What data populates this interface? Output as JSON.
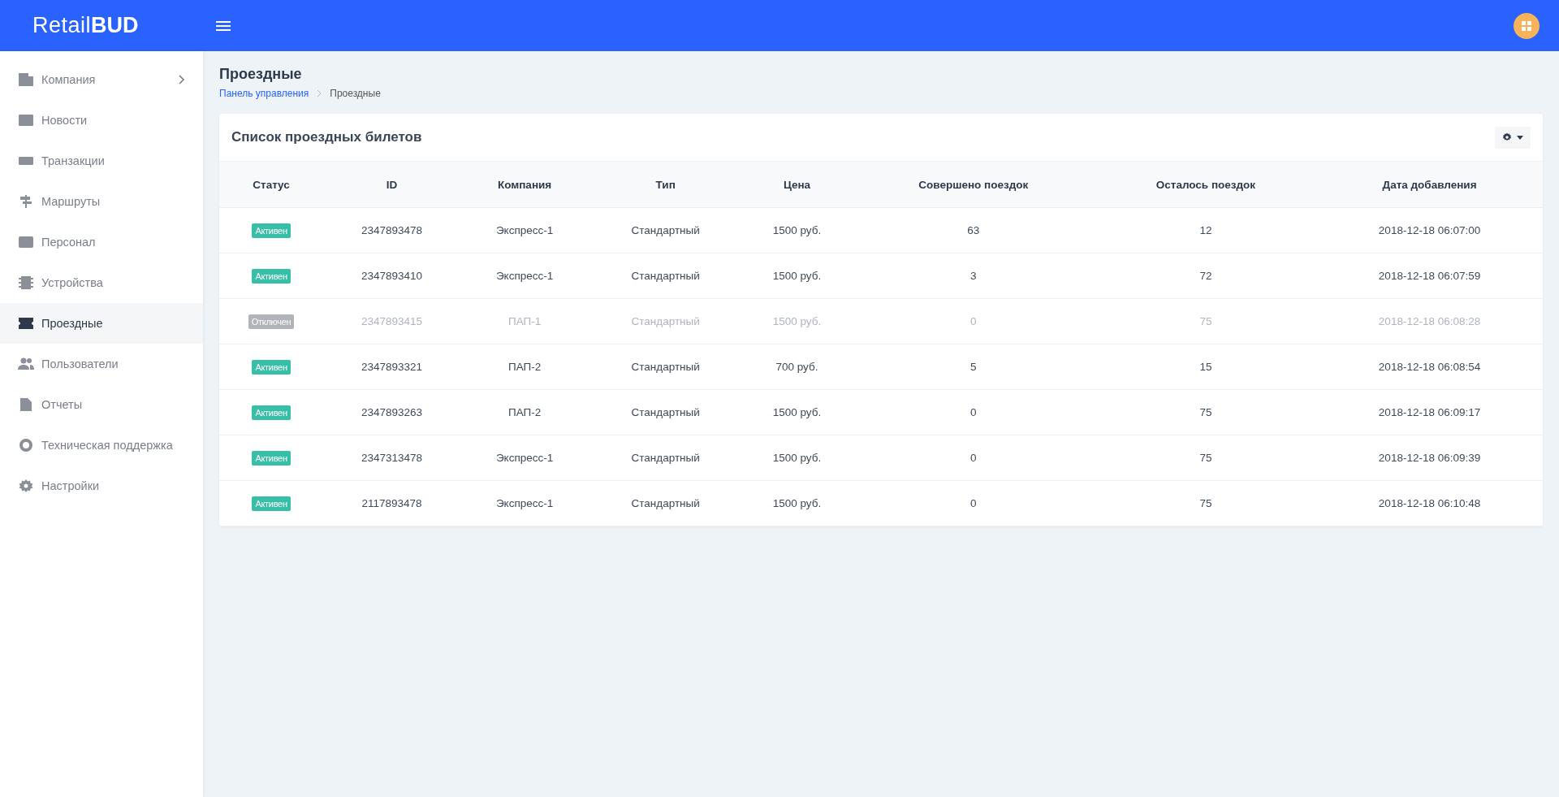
{
  "header": {
    "logo_light": "Retail",
    "logo_bold": "BUD"
  },
  "sidebar": {
    "items": [
      {
        "label": "Компания",
        "selected": false,
        "expandable": true
      },
      {
        "label": "Новости",
        "selected": false,
        "expandable": false
      },
      {
        "label": "Транзакции",
        "selected": false,
        "expandable": false
      },
      {
        "label": "Маршруты",
        "selected": false,
        "expandable": false
      },
      {
        "label": "Персонал",
        "selected": false,
        "expandable": false
      },
      {
        "label": "Устройства",
        "selected": false,
        "expandable": false
      },
      {
        "label": "Проездные",
        "selected": true,
        "expandable": false
      },
      {
        "label": "Пользователи",
        "selected": false,
        "expandable": false
      },
      {
        "label": "Отчеты",
        "selected": false,
        "expandable": false
      },
      {
        "label": "Техническая поддержка",
        "selected": false,
        "expandable": false
      },
      {
        "label": "Настройки",
        "selected": false,
        "expandable": false
      }
    ]
  },
  "page": {
    "title": "Проездные",
    "breadcrumb": [
      "Панель управления",
      "Проездные"
    ]
  },
  "card": {
    "title": "Список проездных билетов",
    "table": {
      "columns": [
        "Статус",
        "ID",
        "Компания",
        "Тип",
        "Цена",
        "Совершено поездок",
        "Осталось поездок",
        "Дата добавления"
      ],
      "rows": [
        {
          "disabled": false,
          "cells": [
            "Активен",
            "2347893478",
            "Экспресс-1",
            "Стандартный",
            "1500 руб.",
            "63",
            "12",
            "2018-12-18 06:07:00"
          ]
        },
        {
          "disabled": false,
          "cells": [
            "Активен",
            "2347893410",
            "Экспресс-1",
            "Стандартный",
            "1500 руб.",
            "3",
            "72",
            "2018-12-18 06:07:59"
          ]
        },
        {
          "disabled": true,
          "cells": [
            "Отключен",
            "2347893415",
            "ПАП-1",
            "Стандартный",
            "1500 руб.",
            "0",
            "75",
            "2018-12-18 06:08:28"
          ]
        },
        {
          "disabled": false,
          "cells": [
            "Активен",
            "2347893321",
            "ПАП-2",
            "Стандартный",
            "700 руб.",
            "5",
            "15",
            "2018-12-18 06:08:54"
          ]
        },
        {
          "disabled": false,
          "cells": [
            "Активен",
            "2347893263",
            "ПАП-2",
            "Стандартный",
            "1500 руб.",
            "0",
            "75",
            "2018-12-18 06:09:17"
          ]
        },
        {
          "disabled": false,
          "cells": [
            "Активен",
            "2347313478",
            "Экспресс-1",
            "Стандартный",
            "1500 руб.",
            "0",
            "75",
            "2018-12-18 06:09:39"
          ]
        },
        {
          "disabled": false,
          "cells": [
            "Активен",
            "2117893478",
            "Экспресс-1",
            "Стандартный",
            "1500 руб.",
            "0",
            "75",
            "2018-12-18 06:10:48"
          ]
        }
      ]
    }
  }
}
